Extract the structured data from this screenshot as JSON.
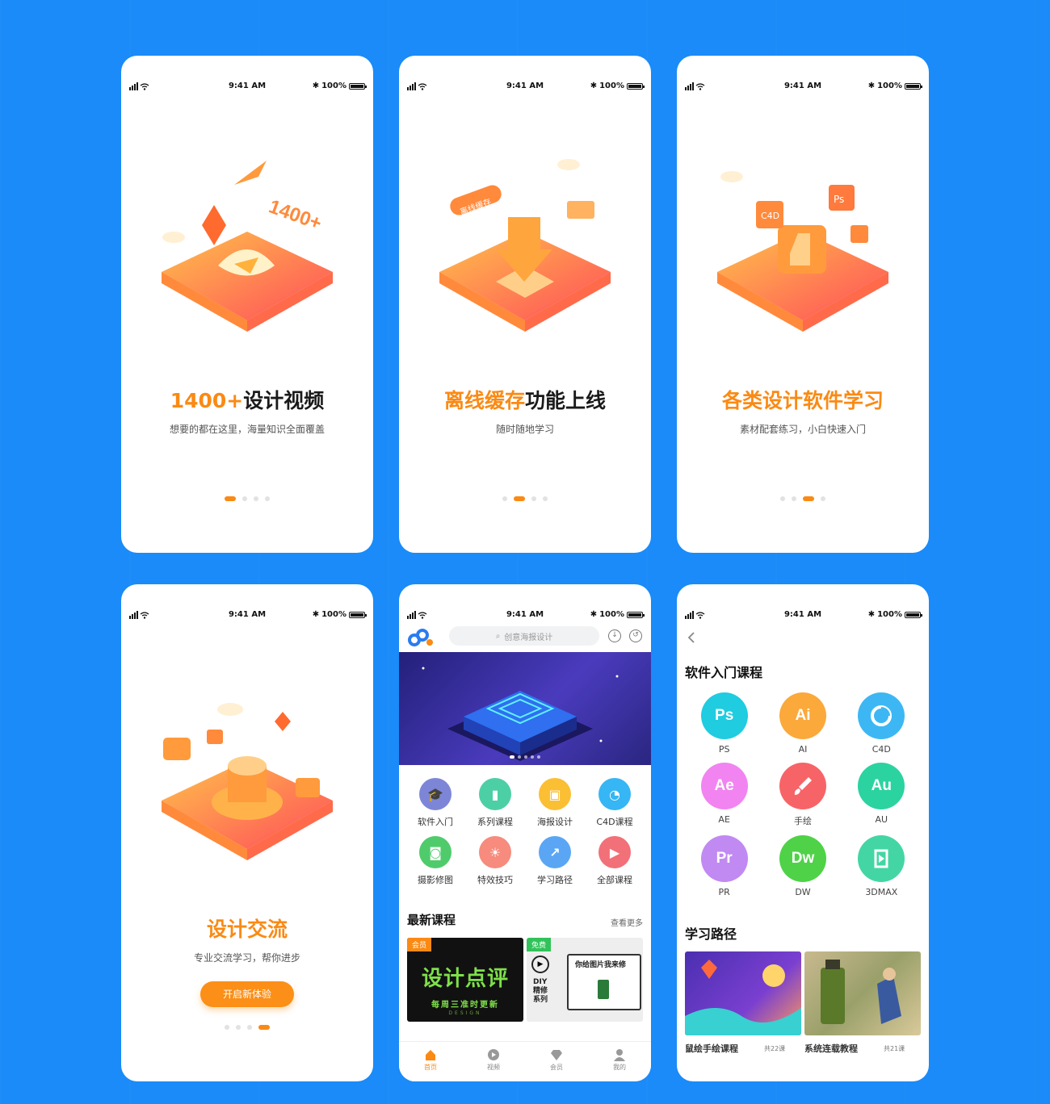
{
  "status": {
    "time": "9:41 AM",
    "battery": "100%"
  },
  "onboarding": [
    {
      "headline_accent": "1400+",
      "headline_rest": "设计视频",
      "subtitle": "想要的都在这里，海量知识全面覆盖",
      "active_dot": 0,
      "illus_text": "1400+"
    },
    {
      "headline_accent": "离线缓存",
      "headline_rest": "功能上线",
      "subtitle": "随时随地学习",
      "active_dot": 1,
      "illus_text": "离线缓存"
    },
    {
      "headline_accent": "各类设计软件学习",
      "headline_rest": "",
      "subtitle": "素材配套练习，小白快速入门",
      "active_dot": 2,
      "illus_text": "C4D"
    },
    {
      "headline_accent": "设计交流",
      "headline_rest": "",
      "subtitle": "专业交流学习，帮你进步",
      "active_dot": 3,
      "cta": "开启新体验"
    }
  ],
  "home": {
    "search_placeholder": "创意海报设计",
    "categories": [
      {
        "label": "软件入门",
        "color": "#7d86d6",
        "icon": "graduation-cap-icon",
        "glyph": "🎓"
      },
      {
        "label": "系列课程",
        "color": "#4dcfa5",
        "icon": "book-icon",
        "glyph": "▮"
      },
      {
        "label": "海报设计",
        "color": "#fbbf34",
        "icon": "image-icon",
        "glyph": "▣"
      },
      {
        "label": "C4D课程",
        "color": "#36b6f4",
        "icon": "c4d-icon",
        "glyph": "◔"
      },
      {
        "label": "摄影修图",
        "color": "#4fcb6c",
        "icon": "camera-icon",
        "glyph": "◙"
      },
      {
        "label": "特效技巧",
        "color": "#f68b7e",
        "icon": "bulb-icon",
        "glyph": "☀"
      },
      {
        "label": "学习路径",
        "color": "#5aa6f5",
        "icon": "trend-icon",
        "glyph": "↗"
      },
      {
        "label": "全部课程",
        "color": "#f27078",
        "icon": "play-icon",
        "glyph": "▶"
      }
    ],
    "latest_title": "最新课程",
    "see_more": "查看更多",
    "cards": [
      {
        "badge": "会员",
        "badge_color": "#fa8a14",
        "title": "设计点评",
        "subtitle": "每周三准时更新",
        "tag": "DESIGN"
      },
      {
        "badge": "免费",
        "badge_color": "#31c35a",
        "side": [
          "DIY",
          "精修",
          "系列"
        ],
        "headline": "你给图片我来修"
      }
    ],
    "tabs": [
      {
        "label": "首页",
        "icon": "home-icon",
        "active": true
      },
      {
        "label": "视频",
        "icon": "video-icon",
        "active": false
      },
      {
        "label": "会员",
        "icon": "diamond-icon",
        "active": false
      },
      {
        "label": "我的",
        "icon": "user-icon",
        "active": false
      }
    ]
  },
  "courses": {
    "title": "软件入门课程",
    "items": [
      {
        "abbr": "Ps",
        "label": "PS",
        "color": "#1fcce0"
      },
      {
        "abbr": "Ai",
        "label": "AI",
        "color": "#fba93b"
      },
      {
        "abbr": "",
        "label": "C4D",
        "color": "#3db7f4"
      },
      {
        "abbr": "Ae",
        "label": "AE",
        "color": "#f184f0"
      },
      {
        "abbr": "",
        "label": "手绘",
        "color": "#f76467"
      },
      {
        "abbr": "Au",
        "label": "AU",
        "color": "#2bd3a0"
      },
      {
        "abbr": "Pr",
        "label": "PR",
        "color": "#c08af2"
      },
      {
        "abbr": "Dw",
        "label": "DW",
        "color": "#4fd248"
      },
      {
        "abbr": "",
        "label": "3DMAX",
        "color": "#43d6a4"
      }
    ],
    "path_title": "学习路径",
    "paths": [
      {
        "title": "鼠绘手绘课程",
        "count": "共22课"
      },
      {
        "title": "系统连载教程",
        "count": "共21课"
      }
    ]
  }
}
